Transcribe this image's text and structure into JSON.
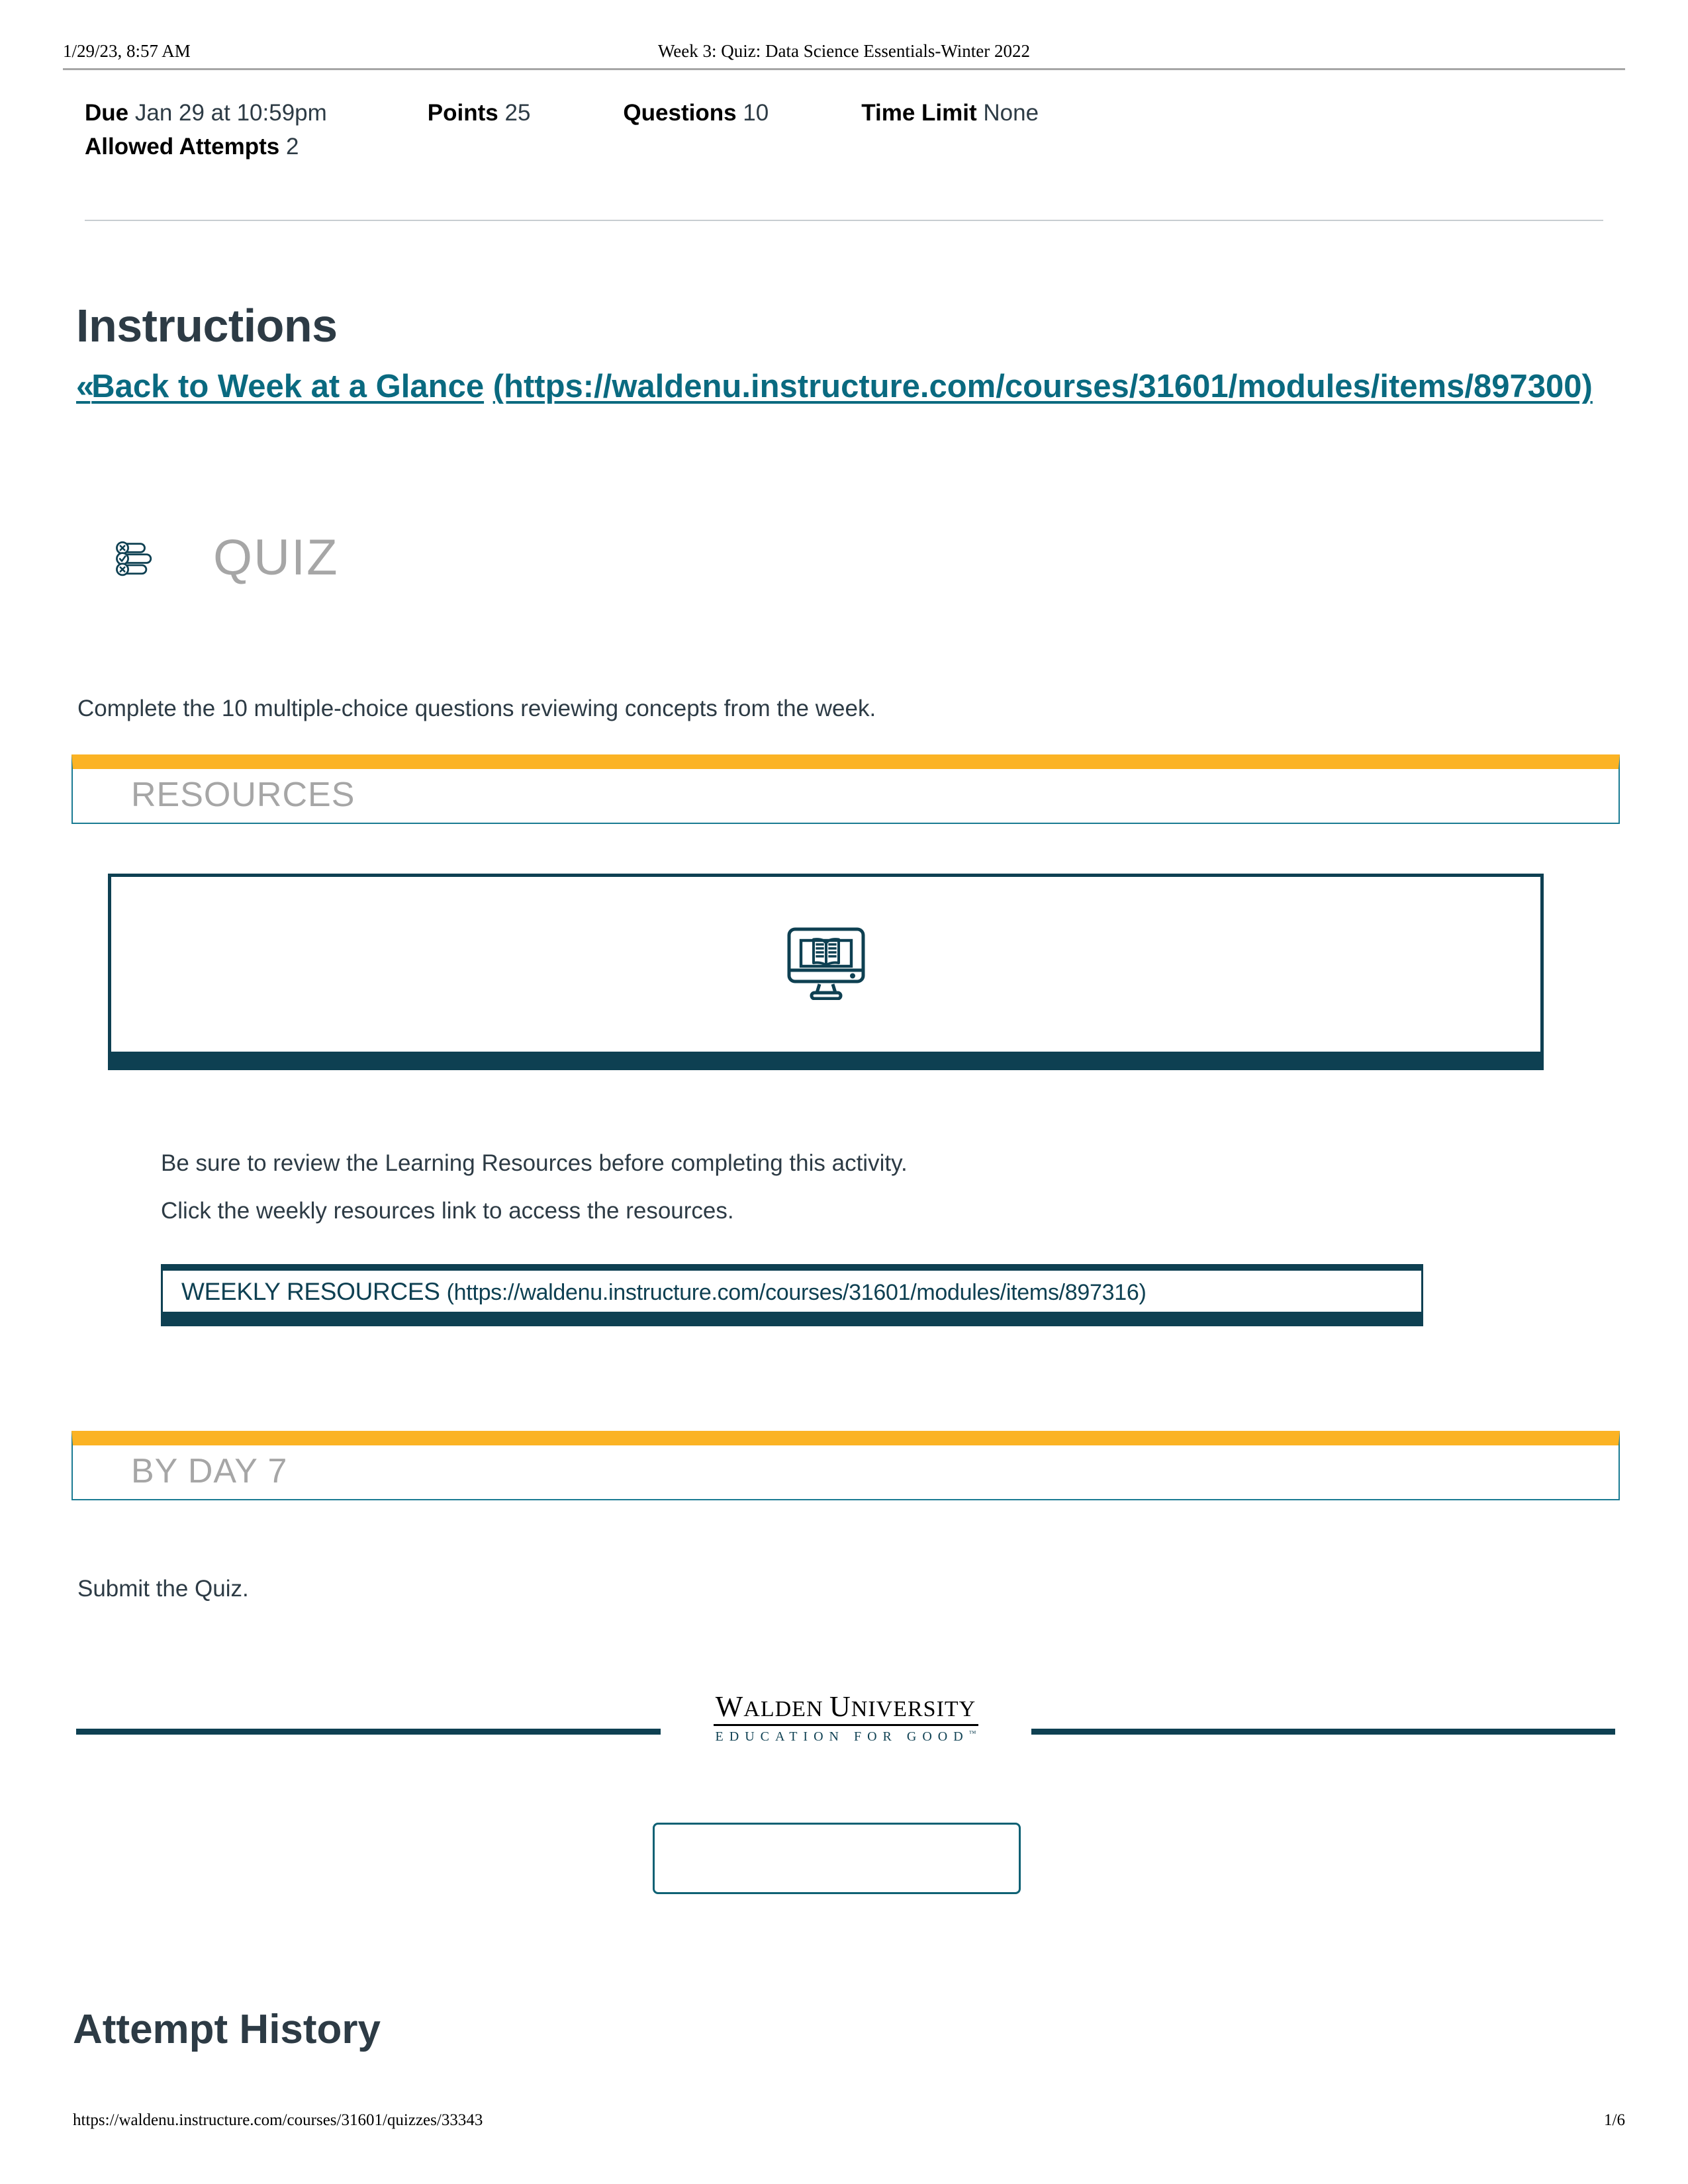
{
  "print_header": {
    "date": "1/29/23, 8:57 AM",
    "title": "Week 3: Quiz: Data Science Essentials-Winter 2022"
  },
  "meta": {
    "due_label": "Due",
    "due_value": "Jan 29 at 10:59pm",
    "points_label": "Points",
    "points_value": "25",
    "questions_label": "Questions",
    "questions_value": "10",
    "time_limit_label": "Time Limit",
    "time_limit_value": "None",
    "attempts_label": "Allowed Attempts",
    "attempts_value": "2"
  },
  "instructions": {
    "heading": "Instructions",
    "back_link_chevron": "«",
    "back_link_text": "Back to Week at a Glance",
    "back_link_url": "(https://waldenu.instructure.com/courses/31601/modules/items/897300)"
  },
  "quiz_block": {
    "icon": "quiz-checklist-icon",
    "label": "QUIZ",
    "description": "Complete the 10 multiple-choice questions reviewing concepts from the week."
  },
  "resources_section": {
    "label": "RESOURCES",
    "panel_icon": "monitor-book-icon",
    "copy_line_1": "Be sure to review the Learning Resources before completing this activity.",
    "copy_line_2": "Click the weekly resources link to access the resources.",
    "weekly_button_label": "WEEKLY RESOURCES",
    "weekly_button_url": "(https://waldenu.instructure.com/courses/31601/modules/items/897316)"
  },
  "byday_section": {
    "label": "BY DAY 7",
    "copy": "Submit the Quiz."
  },
  "logo": {
    "name_part_1": "W",
    "name_part_2": "ALDEN ",
    "name_part_3": "U",
    "name_part_4": "NIVERSITY",
    "tagline": "EDUCATION FOR GOOD",
    "tagline_mark": "™"
  },
  "attempt_history": {
    "heading": "Attempt History"
  },
  "print_footer": {
    "url": "https://waldenu.instructure.com/courses/31601/quizzes/33343",
    "page": "1/6"
  },
  "colors": {
    "accent_orange": "#fbb324",
    "teal_border": "#1a7b93",
    "dark_teal": "#0e4052",
    "link_teal": "#0a6a80",
    "gray_label": "#a6a6a6",
    "text": "#2d3b45"
  }
}
